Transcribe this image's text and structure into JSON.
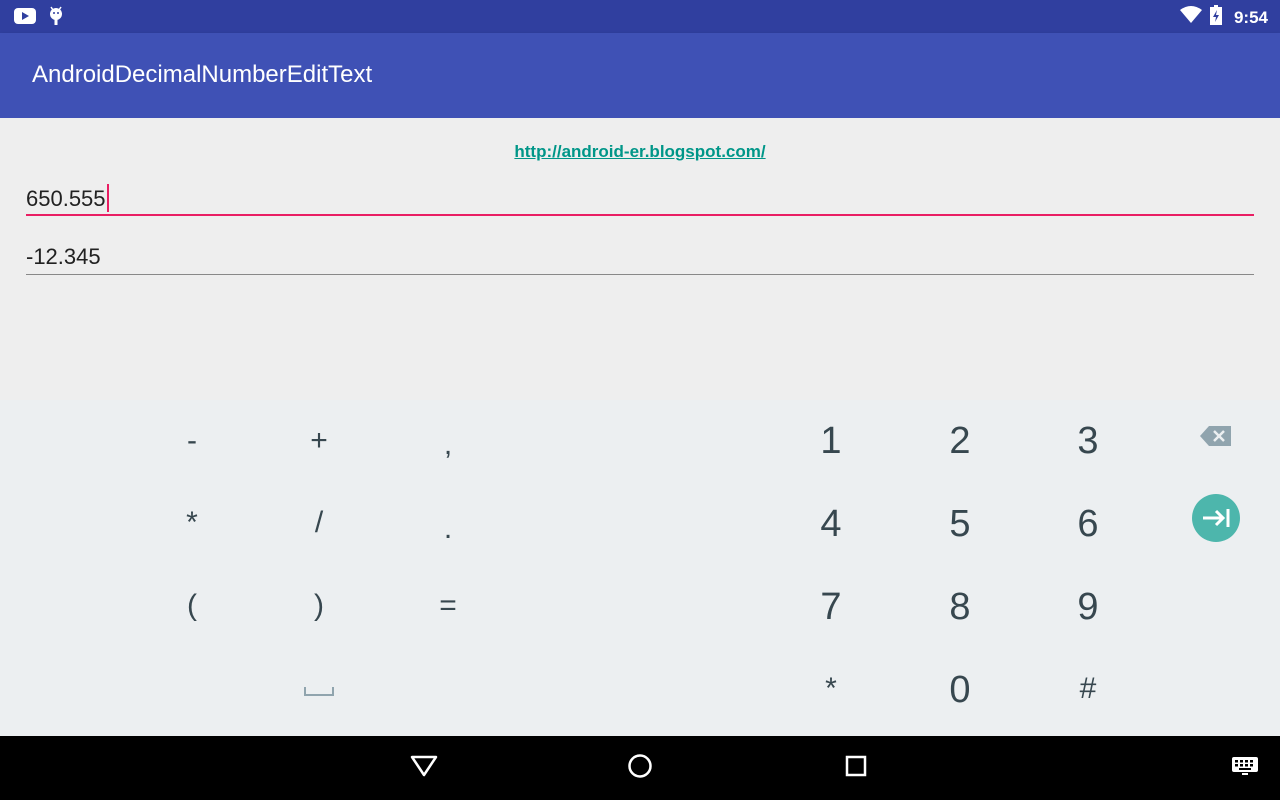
{
  "status_bar": {
    "time": "9:54",
    "left_icons": [
      "youtube-icon",
      "android-debug-icon"
    ],
    "right_icons": [
      "wifi-icon",
      "battery-charging-icon"
    ]
  },
  "app_bar": {
    "title": "AndroidDecimalNumberEditText"
  },
  "content": {
    "link": "http://android-er.blogspot.com/",
    "field1_value": "650.555",
    "field2_value": "-12.345",
    "accent_color": "#e91e63"
  },
  "keyboard": {
    "symbol_keys": [
      [
        "-",
        "+",
        ","
      ],
      [
        "*",
        "/",
        "."
      ],
      [
        "(",
        ")",
        "="
      ]
    ],
    "number_keys": [
      [
        "1",
        "2",
        "3"
      ],
      [
        "4",
        "5",
        "6"
      ],
      [
        "7",
        "8",
        "9"
      ],
      [
        "*",
        "0",
        "#"
      ]
    ],
    "space_key": "space-icon",
    "backspace_key": "backspace-icon",
    "next_key": "next-field-icon",
    "next_color": "#4db6ac"
  },
  "nav_bar": {
    "buttons": [
      "back-icon",
      "home-icon",
      "recents-icon",
      "keyboard-switch-icon"
    ]
  }
}
